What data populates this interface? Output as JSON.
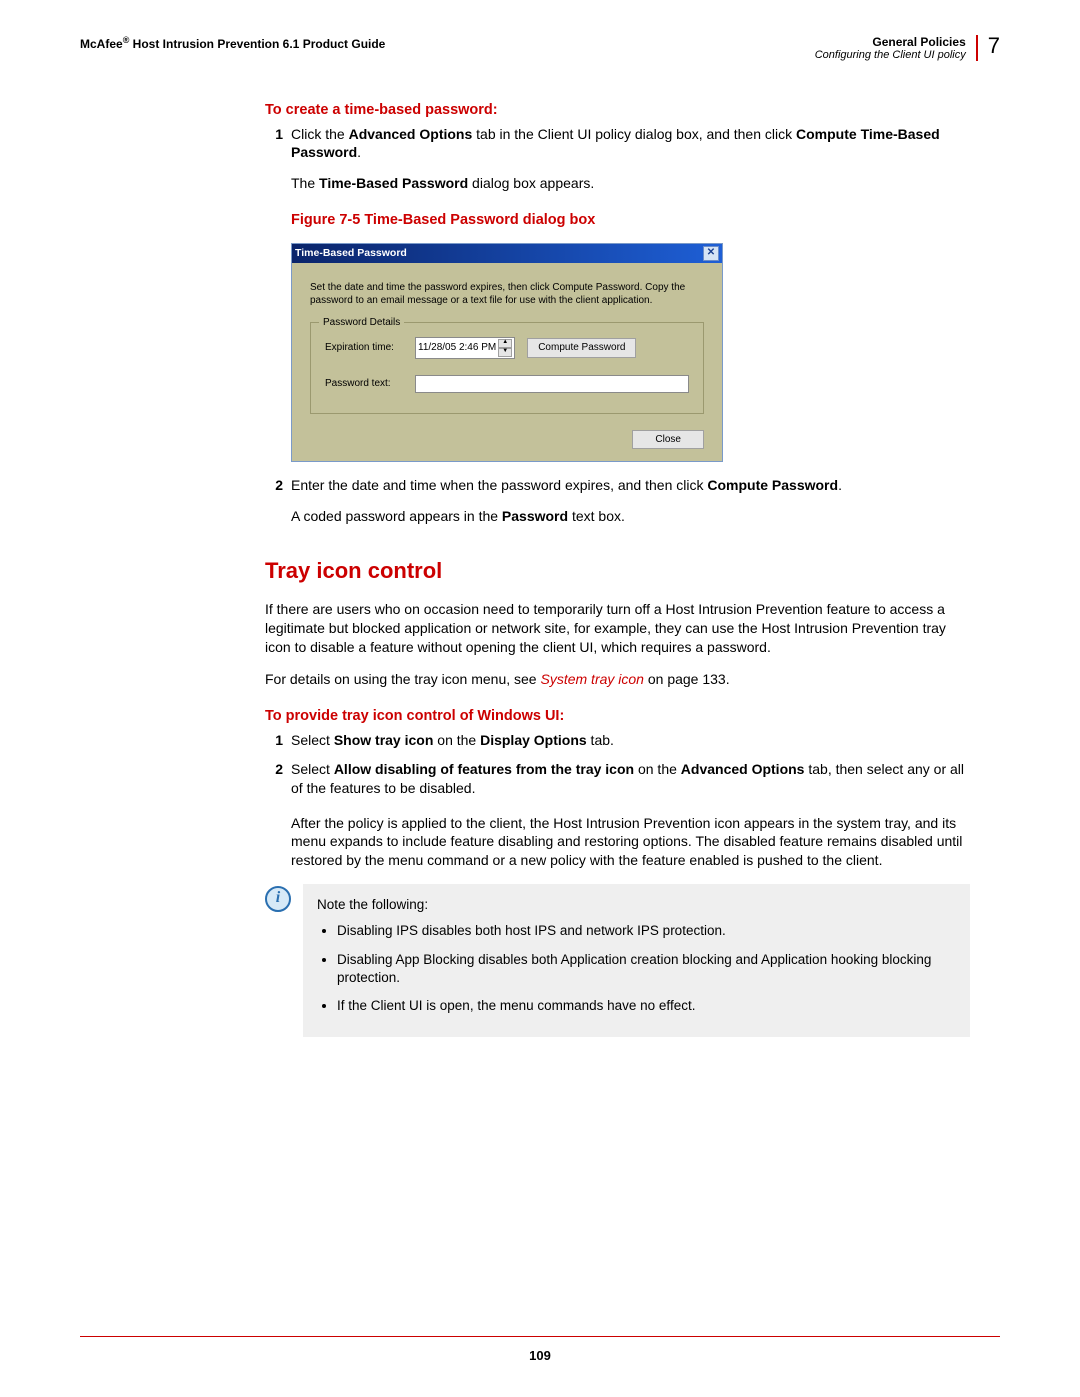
{
  "header": {
    "left_prefix": "McAfee",
    "left_product": " Host Intrusion Prevention 6.1 Product Guide",
    "right_section": "General Policies",
    "right_sub": "Configuring the Client UI policy",
    "chapter": "7"
  },
  "sec1": {
    "heading": "To create a time-based password:",
    "step1_pre": "Click the ",
    "step1_b1": "Advanced Options",
    "step1_mid": " tab in the Client UI policy dialog box, and then click ",
    "step1_b2": "Compute Time-Based Password",
    "step1_end": ".",
    "result_pre": "The ",
    "result_b": "Time-Based Password",
    "result_end": " dialog box appears.",
    "fig_caption": "Figure 7-5  Time-Based Password dialog box"
  },
  "dialog": {
    "title": "Time-Based Password",
    "instr": "Set the date and time the password expires, then click Compute Password. Copy the password to an email message or a text file for use with the client application.",
    "legend": "Password Details",
    "lbl_exp": "Expiration time:",
    "exp_value": "11/28/05 2:46 PM",
    "btn_compute": "Compute Password",
    "lbl_pwd": "Password text:",
    "btn_close": "Close"
  },
  "sec1b": {
    "step2_pre": "Enter the date and time when the password expires, and then click ",
    "step2_b": "Compute Password",
    "step2_end": ".",
    "result2_pre": "A coded password appears in the ",
    "result2_b": "Password",
    "result2_end": " text box."
  },
  "tray": {
    "heading": "Tray icon control",
    "para1": "If there are users who on occasion need to temporarily turn off a Host Intrusion Prevention feature to access a legitimate but blocked application or network site, for example, they can use the Host Intrusion Prevention tray icon to disable a feature without opening the client UI, which requires a password.",
    "para2_pre": "For details on using the tray icon menu, see ",
    "para2_link": "System tray icon",
    "para2_end": " on page 133.",
    "sub_heading": "To provide tray icon control of Windows UI:",
    "step1_pre": "Select ",
    "step1_b1": "Show tray icon",
    "step1_mid": " on the ",
    "step1_b2": "Display Options",
    "step1_end": " tab.",
    "step2_pre": "Select ",
    "step2_b1": "Allow disabling of features from the tray icon",
    "step2_mid": " on the ",
    "step2_b2": "Advanced Options",
    "step2_end": " tab, then select any or all of the features to be disabled.",
    "para3": "After the policy is applied to the client, the Host Intrusion Prevention icon appears in the system tray, and its menu expands to include feature disabling and restoring options. The disabled feature remains disabled until restored by the menu command or a new policy with the feature enabled is pushed to the client."
  },
  "note": {
    "intro": "Note the following:",
    "b1": "Disabling IPS disables both host IPS and network IPS protection.",
    "b2": "Disabling App Blocking disables both Application creation blocking and Application hooking blocking protection.",
    "b3": "If the Client UI is open, the menu commands have no effect."
  },
  "page_number": "109"
}
